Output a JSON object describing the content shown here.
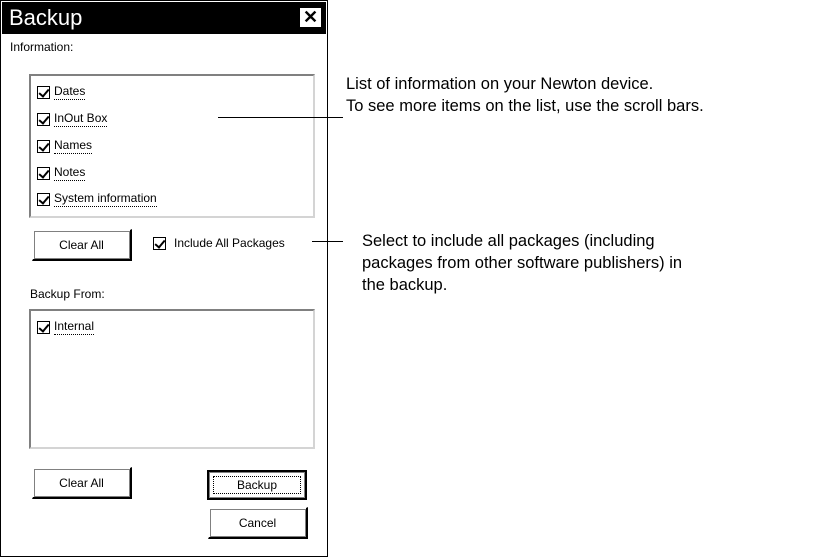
{
  "window": {
    "title": "Backup",
    "close_glyph": "✕"
  },
  "information": {
    "label": "Information:",
    "items": [
      {
        "label": "Dates",
        "checked": true
      },
      {
        "label": "InOut Box",
        "checked": true
      },
      {
        "label": "Names",
        "checked": true
      },
      {
        "label": "Notes",
        "checked": true
      },
      {
        "label": "System information",
        "checked": true
      }
    ],
    "clear_all_label": "Clear All",
    "include_packages_label": "Include All Packages",
    "include_packages_checked": true
  },
  "backup_from": {
    "label": "Backup From:",
    "items": [
      {
        "label": "Internal",
        "checked": true
      }
    ],
    "clear_all_label": "Clear All"
  },
  "actions": {
    "backup_label": "Backup",
    "cancel_label": "Cancel"
  },
  "callouts": {
    "list_info": [
      "List of information on your Newton device.",
      "To see more items on the list, use the scroll bars."
    ],
    "packages": [
      "Select to include all packages (including",
      "packages from other software publishers) in",
      "the backup."
    ]
  }
}
